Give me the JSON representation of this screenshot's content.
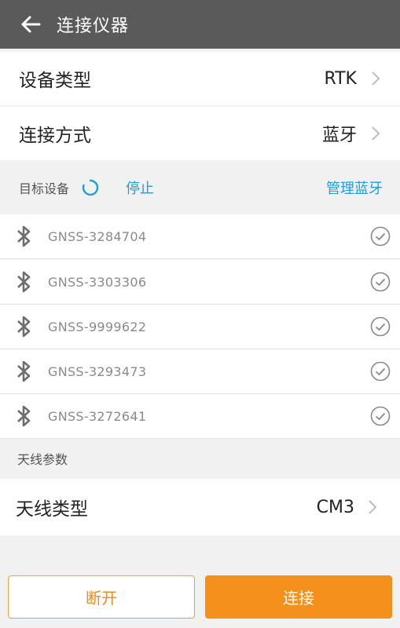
{
  "header": {
    "title": "连接仪器"
  },
  "device_type": {
    "label": "设备类型",
    "value": "RTK"
  },
  "connect_mode": {
    "label": "连接方式",
    "value": "蓝牙"
  },
  "target": {
    "label": "目标设备",
    "stop": "停止",
    "manage": "管理蓝牙"
  },
  "devices": [
    "GNSS-3284704",
    "GNSS-3303306",
    "GNSS-9999622",
    "GNSS-3293473",
    "GNSS-3272641"
  ],
  "antenna_section": {
    "label": "天线参数"
  },
  "antenna_type": {
    "label": "天线类型",
    "value": "CM3"
  },
  "buttons": {
    "disconnect": "断开",
    "connect": "连接"
  },
  "colors": {
    "topbar": "#5a5a5a",
    "accent_blue": "#1aa0dc",
    "accent_orange": "#f5901c"
  }
}
